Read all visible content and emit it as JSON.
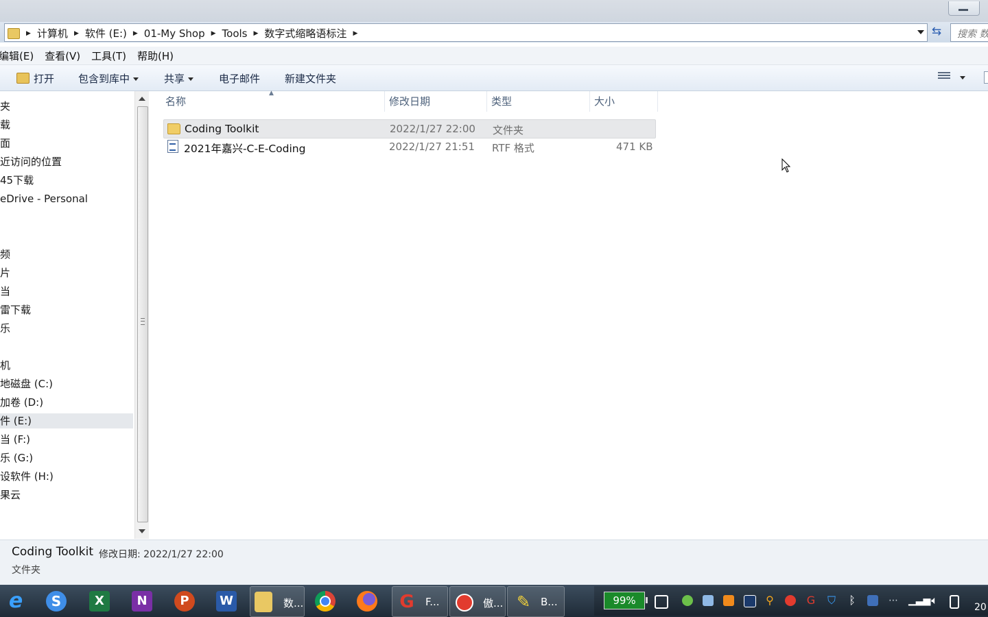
{
  "window": {
    "breadcrumbs": [
      "计算机",
      "软件 (E:)",
      "01-My Shop",
      "Tools",
      "数字式缩略语标注"
    ],
    "search_placeholder": "搜索 数"
  },
  "menu": [
    "编辑(E)",
    "查看(V)",
    "工具(T)",
    "帮助(H)"
  ],
  "toolbar": {
    "open": "打开",
    "include_library": "包含到库中",
    "share": "共享",
    "email": "电子邮件",
    "new_folder": "新建文件夹"
  },
  "nav_items": [
    {
      "label": "夹",
      "selected": false
    },
    {
      "label": "载",
      "selected": false
    },
    {
      "label": "面",
      "selected": false
    },
    {
      "label": "近访问的位置",
      "selected": false
    },
    {
      "label": "45下载",
      "selected": false
    },
    {
      "label": "eDrive - Personal",
      "selected": false
    },
    {
      "label": "频",
      "selected": false
    },
    {
      "label": "片",
      "selected": false
    },
    {
      "label": "当",
      "selected": false
    },
    {
      "label": "雷下载",
      "selected": false
    },
    {
      "label": "乐",
      "selected": false
    },
    {
      "label": "机",
      "selected": false
    },
    {
      "label": "地磁盘 (C:)",
      "selected": false
    },
    {
      "label": "加卷 (D:)",
      "selected": false
    },
    {
      "label": "件 (E:)",
      "selected": true
    },
    {
      "label": "当 (F:)",
      "selected": false
    },
    {
      "label": "乐 (G:)",
      "selected": false
    },
    {
      "label": "设软件 (H:)",
      "selected": false
    },
    {
      "label": "果云",
      "selected": false
    }
  ],
  "columns": {
    "name": "名称",
    "modified": "修改日期",
    "type": "类型",
    "size": "大小"
  },
  "files": [
    {
      "name": "Coding Toolkit",
      "modified": "2022/1/27 22:00",
      "type": "文件夹",
      "size": "",
      "icon": "folder-icon",
      "selected": true
    },
    {
      "name": "2021年嘉兴-C-E-Coding",
      "modified": "2022/1/27 21:51",
      "type": "RTF 格式",
      "size": "471 KB",
      "icon": "rtf-document-icon",
      "selected": false
    }
  ],
  "details": {
    "name": "Coding Toolkit",
    "modified_label": "修改日期:",
    "modified_value": "2022/1/27 22:00",
    "type": "文件夹"
  },
  "taskbar": {
    "apps": [
      {
        "name": "internet-explorer",
        "label": ""
      },
      {
        "name": "sogou",
        "label": ""
      },
      {
        "name": "excel",
        "label": ""
      },
      {
        "name": "onenote",
        "label": ""
      },
      {
        "name": "powerpoint",
        "label": ""
      },
      {
        "name": "word",
        "label": ""
      },
      {
        "name": "explorer",
        "label": "数..."
      },
      {
        "name": "chrome",
        "label": ""
      },
      {
        "name": "firefox",
        "label": ""
      },
      {
        "name": "foxit",
        "label": "F..."
      },
      {
        "name": "recorder",
        "label": "傲..."
      },
      {
        "name": "highlighter",
        "label": "B..."
      }
    ],
    "battery": "99%",
    "clock": "20"
  },
  "colors": {
    "accent": "#2f5fa6",
    "taskbar": "#263442",
    "battery": "#1a8a2a"
  }
}
